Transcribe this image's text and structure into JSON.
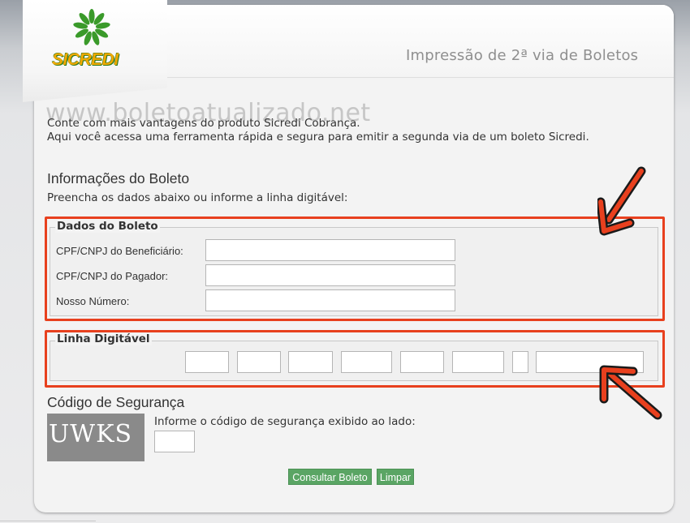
{
  "header": {
    "title": "Impressão de 2ª via de Boletos",
    "logo_text": "SICREDI"
  },
  "watermark": "www.boletoatualizado.net",
  "intro": {
    "line1": "Conte com mais vantagens do produto Sicredi Cobrança.",
    "line2": "Aqui você acessa uma ferramenta rápida e segura para emitir a segunda via de um boleto Sicredi."
  },
  "info": {
    "title": "Informações do Boleto",
    "subtitle": "Preencha os dados abaixo ou informe a linha digitável:"
  },
  "dados": {
    "legend": "Dados do Boleto",
    "fields": [
      {
        "label": "CPF/CNPJ do Beneficiário:",
        "value": ""
      },
      {
        "label": "CPF/CNPJ do Pagador:",
        "value": ""
      },
      {
        "label": "Nosso Número:",
        "value": ""
      }
    ]
  },
  "linha": {
    "legend": "Linha Digitável",
    "segments": [
      "",
      "",
      "",
      "",
      "",
      "",
      "",
      ""
    ]
  },
  "seguranca": {
    "title": "Código de Segurança",
    "captcha_text": "UWKS",
    "hint": "Informe o código de segurança exibido ao lado:",
    "value": ""
  },
  "buttons": {
    "consultar": "Consultar Boleto",
    "limpar": "Limpar"
  },
  "colors": {
    "highlight": "#e8401e",
    "button": "#5aa564",
    "logo_green": "#2d7a1f",
    "logo_yellow": "#f0a800"
  }
}
